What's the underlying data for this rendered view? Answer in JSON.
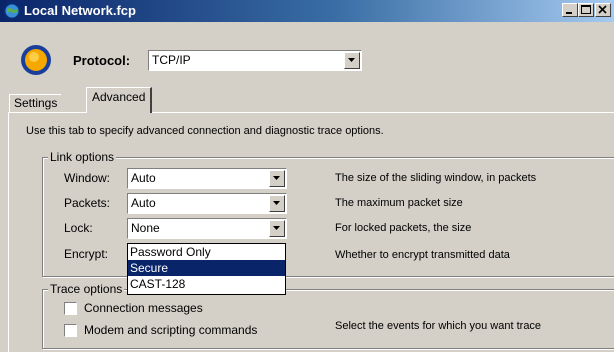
{
  "window": {
    "title": "Local Network.fcp",
    "icon": "globe-icon"
  },
  "protocol": {
    "label": "Protocol:",
    "value": "TCP/IP",
    "icon": "connection-status-orb-icon"
  },
  "tabs": [
    {
      "label": "Settings"
    },
    {
      "label": "Advanced"
    }
  ],
  "intro": "Use this tab to specify advanced connection and diagnostic trace options.",
  "link_options": {
    "title": "Link options",
    "rows": [
      {
        "label": "Window:",
        "value": "Auto",
        "description": "The size of the sliding window, in packets"
      },
      {
        "label": "Packets:",
        "value": "Auto",
        "description": "The maximum packet size"
      },
      {
        "label": "Lock:",
        "value": "None",
        "description": "For locked packets, the size"
      },
      {
        "label": "Encrypt:",
        "description": "Whether to encrypt transmitted data"
      }
    ],
    "encrypt_options": [
      "Password Only",
      "Secure",
      "CAST-128"
    ],
    "encrypt_selected": "Secure"
  },
  "trace_options": {
    "title": "Trace options",
    "items": [
      {
        "label": "Connection messages"
      },
      {
        "label": "Modem and scripting commands"
      }
    ],
    "description": "Select the events for which you want trace"
  },
  "colors": {
    "title_active": "#0a246a",
    "selection": "#0a246a",
    "face": "#d4d0c8"
  }
}
